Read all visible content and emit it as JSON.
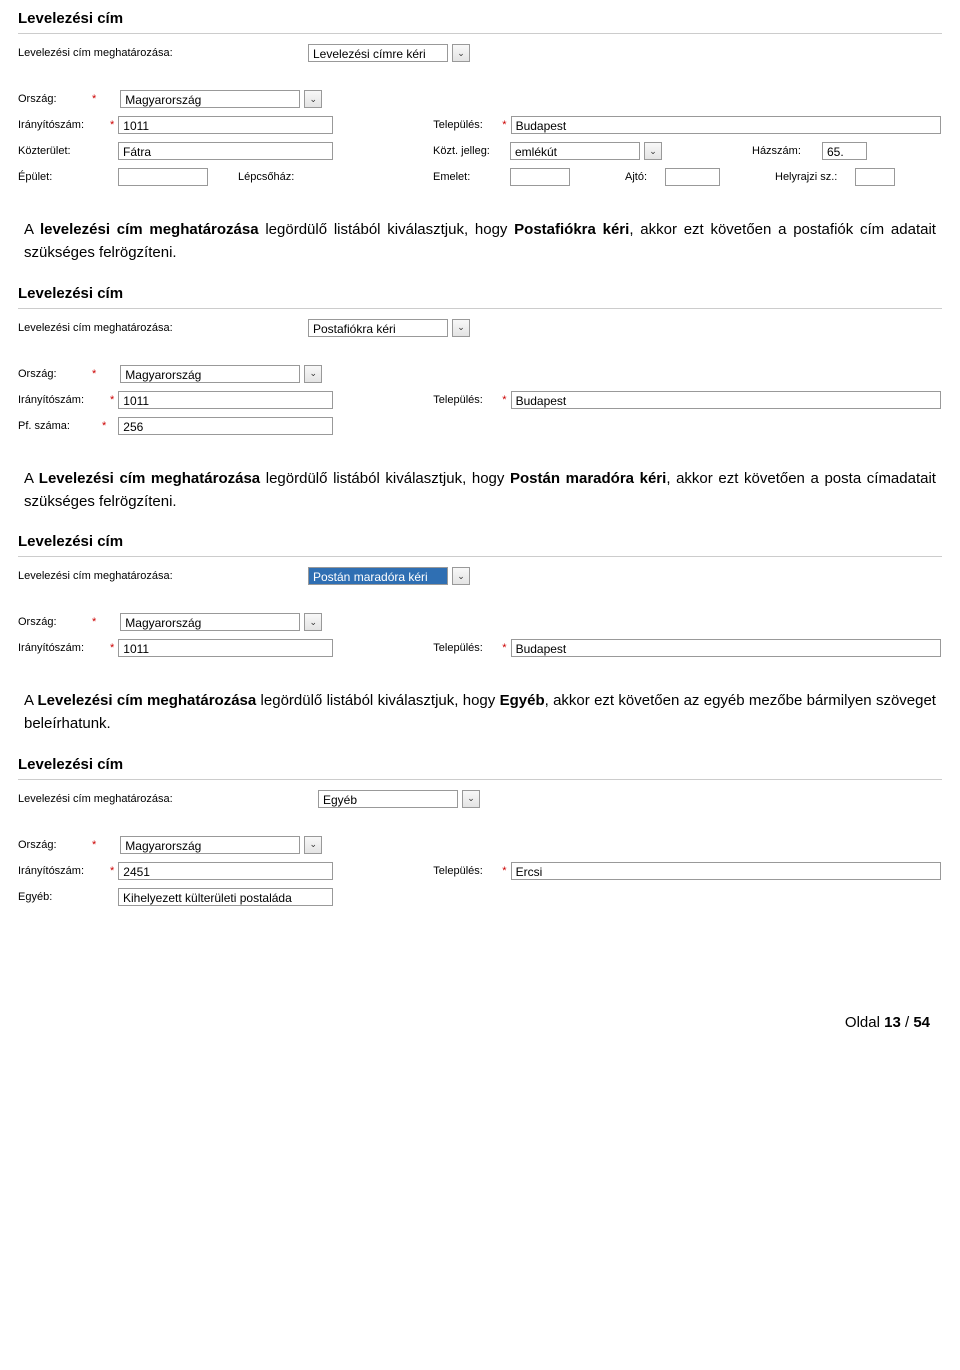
{
  "panel1": {
    "title": "Levelezési cím",
    "det_label": "Levelezési cím meghatározása:",
    "det_value": "Levelezési címre kéri",
    "orszag_label": "Ország:",
    "orszag_value": "Magyarország",
    "irsz_label": "Irányítószám:",
    "irsz_value": "1011",
    "telepules_label": "Település:",
    "telepules_value": "Budapest",
    "kozterulet_label": "Közterület:",
    "kozterulet_value": "Fátra",
    "koztjelleg_label": "Közt. jelleg:",
    "koztjelleg_value": "emlékút",
    "hazszam_label": "Házszám:",
    "hazszam_value": "65.",
    "epulet_label": "Épület:",
    "lepcsohaz_label": "Lépcsőház:",
    "emelet_label": "Emelet:",
    "ajto_label": "Ajtó:",
    "hrsz_label": "Helyrajzi sz.:"
  },
  "para1": {
    "t1": "A ",
    "b1": "levelezési cím meghatározása",
    "t2": " legördülő listából kiválasztjuk, hogy ",
    "b2": "Postafiókra kéri",
    "t3": ", akkor ezt követően a postafiók cím adatait szükséges felrögzíteni."
  },
  "panel2": {
    "title": "Levelezési cím",
    "det_label": "Levelezési cím meghatározása:",
    "det_value": "Postafiókra kéri",
    "orszag_label": "Ország:",
    "orszag_value": "Magyarország",
    "irsz_label": "Irányítószám:",
    "irsz_value": "1011",
    "telepules_label": "Település:",
    "telepules_value": "Budapest",
    "pf_label": "Pf. száma:",
    "pf_value": "256"
  },
  "para2": {
    "t1": "A ",
    "b1": "Levelezési cím meghatározása",
    "t2": " legördülő listából kiválasztjuk, hogy ",
    "b2": "Postán maradóra kéri",
    "t3": ", akkor ezt követően a posta címadatait szükséges felrögzíteni."
  },
  "panel3": {
    "title": "Levelezési cím",
    "det_label": "Levelezési cím meghatározása:",
    "det_value": "Postán maradóra kéri",
    "orszag_label": "Ország:",
    "orszag_value": "Magyarország",
    "irsz_label": "Irányítószám:",
    "irsz_value": "1011",
    "telepules_label": "Település:",
    "telepules_value": "Budapest"
  },
  "para3": {
    "t1": "A ",
    "b1": "Levelezési cím meghatározása",
    "t2": " legördülő listából kiválasztjuk, hogy ",
    "b2": "Egyéb",
    "t3": ", akkor ezt követően az egyéb mezőbe bármilyen szöveget beleírhatunk."
  },
  "panel4": {
    "title": "Levelezési cím",
    "det_label": "Levelezési cím meghatározása:",
    "det_value": "Egyéb",
    "orszag_label": "Ország:",
    "orszag_value": "Magyarország",
    "irsz_label": "Irányítószám:",
    "irsz_value": "2451",
    "telepules_label": "Település:",
    "telepules_value": "Ercsi",
    "egyeb_label": "Egyéb:",
    "egyeb_value": "Kihelyezett külterületi postaláda"
  },
  "footer": {
    "t1": "Oldal ",
    "b1": "13",
    "t2": " / ",
    "b2": "54"
  },
  "req": "*",
  "chevron": "⌄"
}
